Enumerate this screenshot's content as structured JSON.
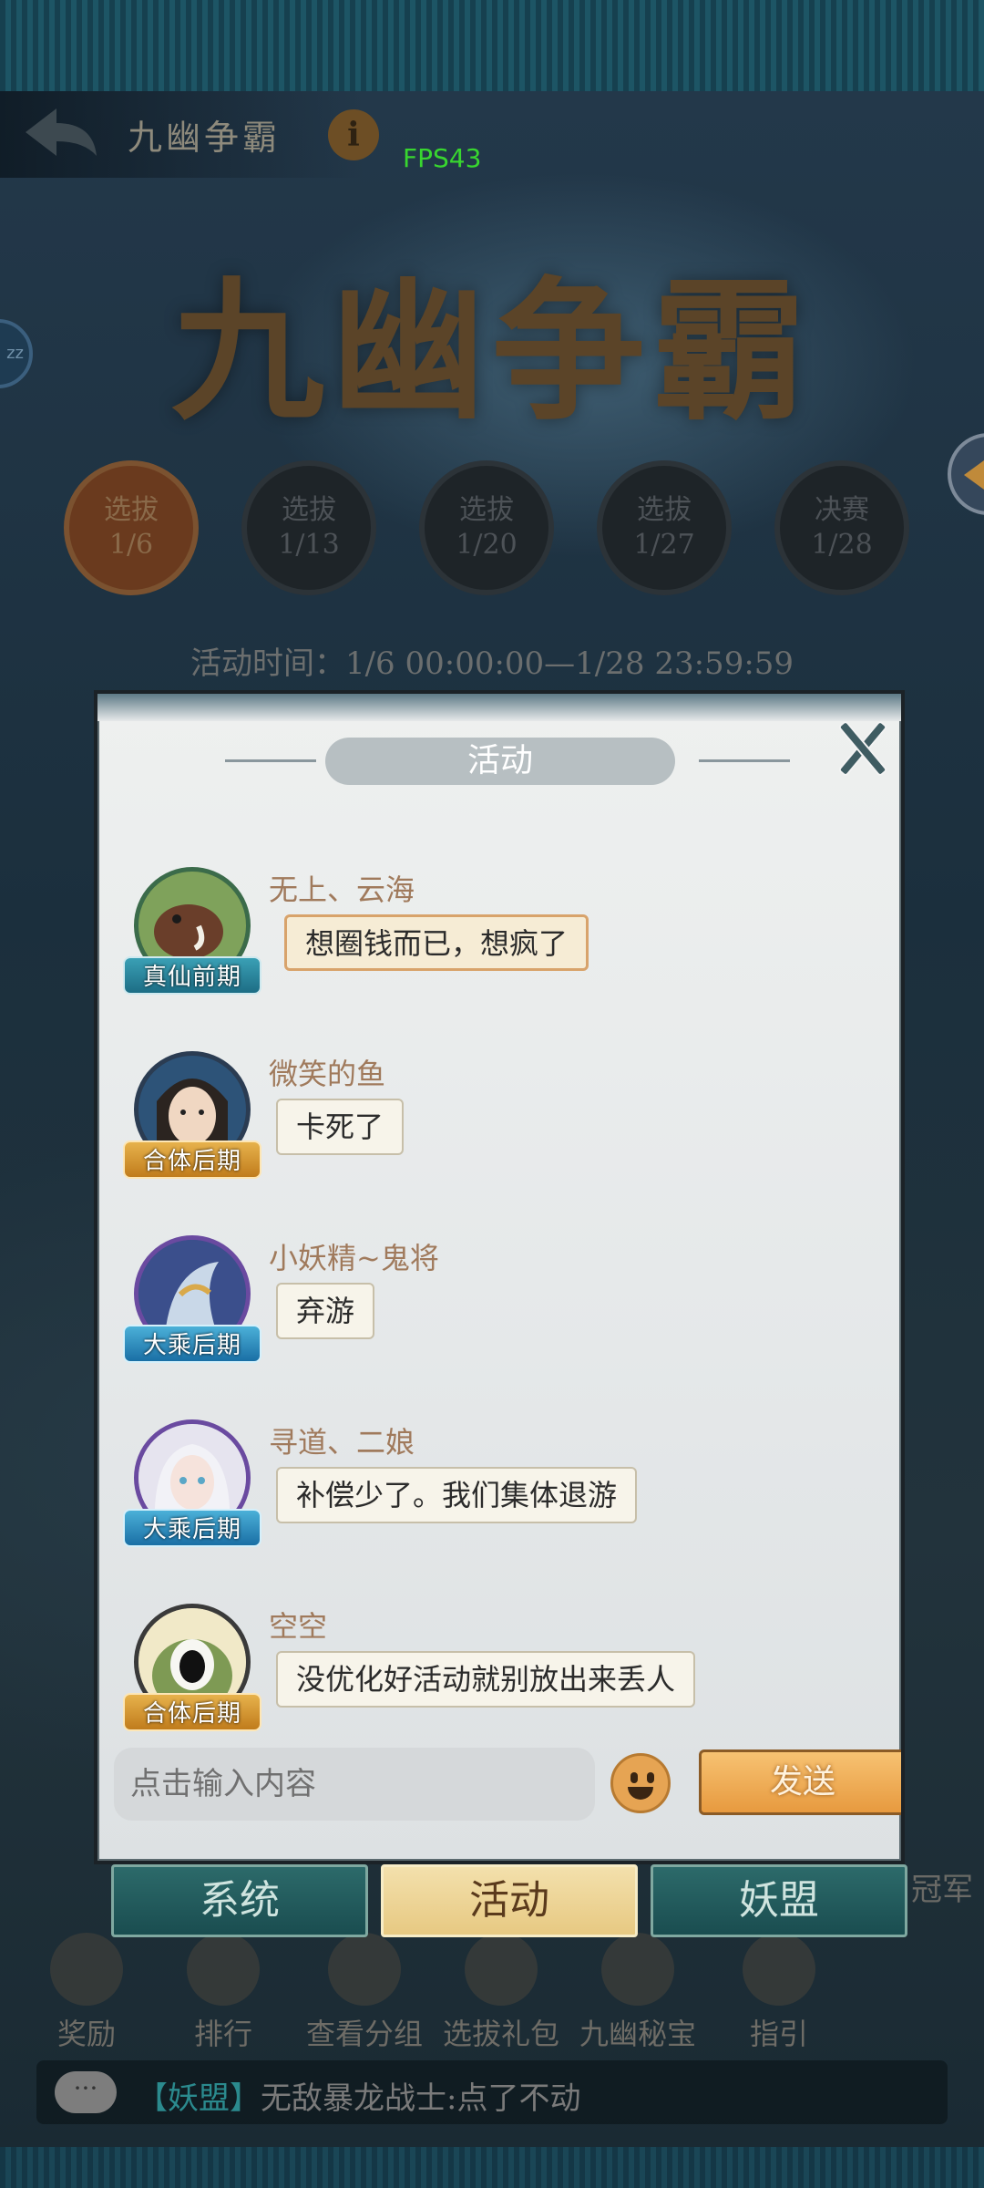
{
  "header": {
    "title": "九幽争霸",
    "info_icon": "i",
    "fps": "FPS43",
    "banner_title": "九幽争霸",
    "side_badge": "zz"
  },
  "stages": [
    {
      "name": "选拔",
      "date": "1/6",
      "active": true
    },
    {
      "name": "选拔",
      "date": "1/13",
      "active": false
    },
    {
      "name": "选拔",
      "date": "1/20",
      "active": false
    },
    {
      "name": "选拔",
      "date": "1/27",
      "active": false
    },
    {
      "name": "决赛",
      "date": "1/28",
      "active": false
    }
  ],
  "activity_time": "活动时间：1/6 00:00:00—1/28 23:59:59",
  "chat": {
    "title": "活动",
    "messages": [
      {
        "sender": "无上、云海",
        "realm": "真仙前期",
        "text": "想圈钱而已，想疯了"
      },
      {
        "sender": "微笑的鱼",
        "realm": "合体后期",
        "text": "卡死了"
      },
      {
        "sender": "小妖精~鬼将",
        "realm": "大乘后期",
        "text": "弃游"
      },
      {
        "sender": "寻道、二娘",
        "realm": "大乘后期",
        "text": "补偿少了。我们集体退游"
      },
      {
        "sender": "空空",
        "realm": "合体后期",
        "text": "没优化好活动就别放出来丢人"
      }
    ],
    "input_placeholder": "点击输入内容",
    "send_label": "发送"
  },
  "tabs": [
    {
      "label": "系统",
      "active": false
    },
    {
      "label": "活动",
      "active": true
    },
    {
      "label": "妖盟",
      "active": false
    }
  ],
  "actions": [
    {
      "label": "奖励",
      "icon": "reward-icon"
    },
    {
      "label": "排行",
      "icon": "ranking-icon"
    },
    {
      "label": "查看分组",
      "icon": "group-icon"
    },
    {
      "label": "选拔礼包",
      "icon": "gift-icon"
    },
    {
      "label": "九幽秘宝",
      "icon": "treasure-icon"
    },
    {
      "label": "指引",
      "icon": "guide-icon"
    }
  ],
  "champion_label": "冠军",
  "ticker": {
    "channel": "【妖盟】",
    "text": "无敌暴龙战士:点了不动"
  },
  "colors": {
    "send_button": "#e79a3f",
    "active_tab": "#e7c982",
    "inactive_tab": "#1a4d50",
    "sender_name": "#a07a5c"
  }
}
